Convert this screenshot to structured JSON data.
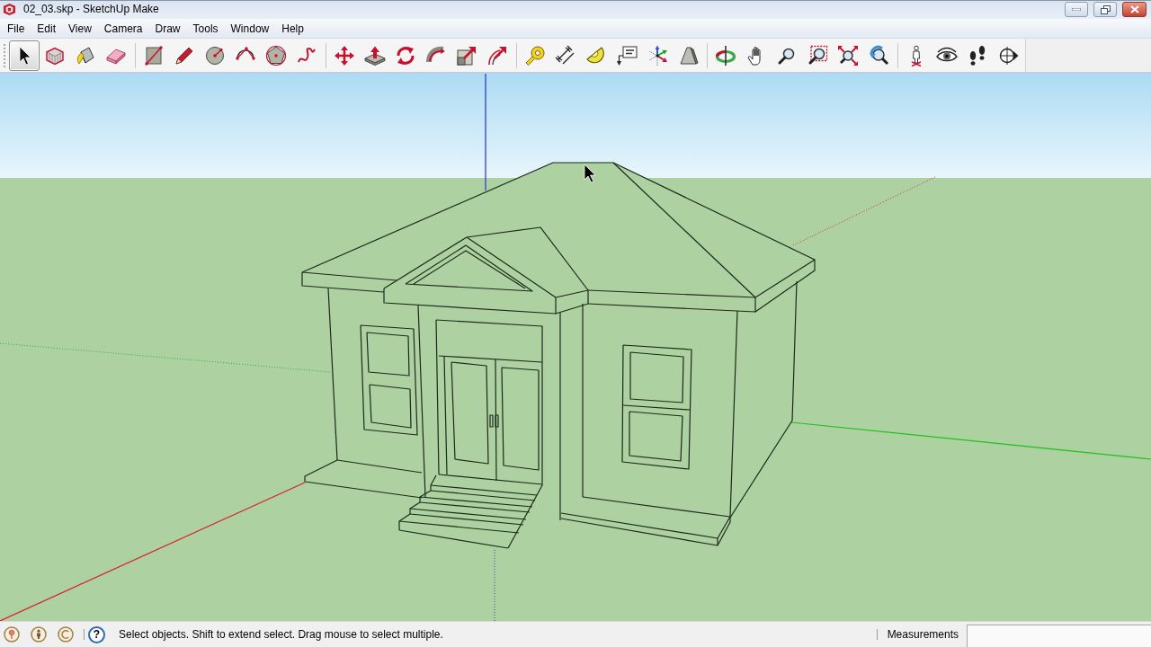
{
  "window": {
    "title": "02_03.skp - SketchUp Make"
  },
  "menu_bar": [
    "File",
    "Edit",
    "View",
    "Camera",
    "Draw",
    "Tools",
    "Window",
    "Help"
  ],
  "toolbar": {
    "groups": [
      {
        "tools": [
          {
            "kind": "select",
            "selected": true
          },
          {
            "kind": "component",
            "selected": false
          },
          {
            "kind": "paint",
            "selected": false
          },
          {
            "kind": "eraser",
            "selected": false
          }
        ]
      },
      {
        "tools": [
          {
            "kind": "rectangle",
            "selected": false
          },
          {
            "kind": "line",
            "selected": false
          },
          {
            "kind": "circle",
            "selected": false
          },
          {
            "kind": "arc",
            "selected": false
          },
          {
            "kind": "polygon",
            "selected": false
          },
          {
            "kind": "freehand",
            "selected": false
          }
        ]
      },
      {
        "tools": [
          {
            "kind": "move",
            "selected": false
          },
          {
            "kind": "pushpull",
            "selected": false
          },
          {
            "kind": "rotate",
            "selected": false
          },
          {
            "kind": "followme",
            "selected": false
          },
          {
            "kind": "scale",
            "selected": false
          },
          {
            "kind": "offset",
            "selected": false
          }
        ]
      },
      {
        "tools": [
          {
            "kind": "tape",
            "selected": false
          },
          {
            "kind": "dimension",
            "selected": false
          },
          {
            "kind": "protractor",
            "selected": false
          },
          {
            "kind": "text",
            "selected": false
          },
          {
            "kind": "axes",
            "selected": false
          },
          {
            "kind": "text3d",
            "selected": false
          }
        ]
      },
      {
        "tools": [
          {
            "kind": "orbit",
            "selected": false
          },
          {
            "kind": "pan",
            "selected": false
          },
          {
            "kind": "zoom",
            "selected": false
          },
          {
            "kind": "zoomwindow",
            "selected": false
          },
          {
            "kind": "zoomextents",
            "selected": false
          },
          {
            "kind": "previous",
            "selected": false
          }
        ]
      },
      {
        "tools": [
          {
            "kind": "position",
            "selected": false
          },
          {
            "kind": "lookaround",
            "selected": false
          },
          {
            "kind": "walk",
            "selected": false
          },
          {
            "kind": "section",
            "selected": false
          }
        ]
      }
    ]
  },
  "status_bar": {
    "icons": [
      {
        "kind": "location"
      },
      {
        "kind": "credits"
      },
      {
        "kind": "signin"
      }
    ],
    "help": "?",
    "hint": "Select objects. Shift to extend select. Drag mouse to select multiple.",
    "measurements_label": "Measurements"
  }
}
